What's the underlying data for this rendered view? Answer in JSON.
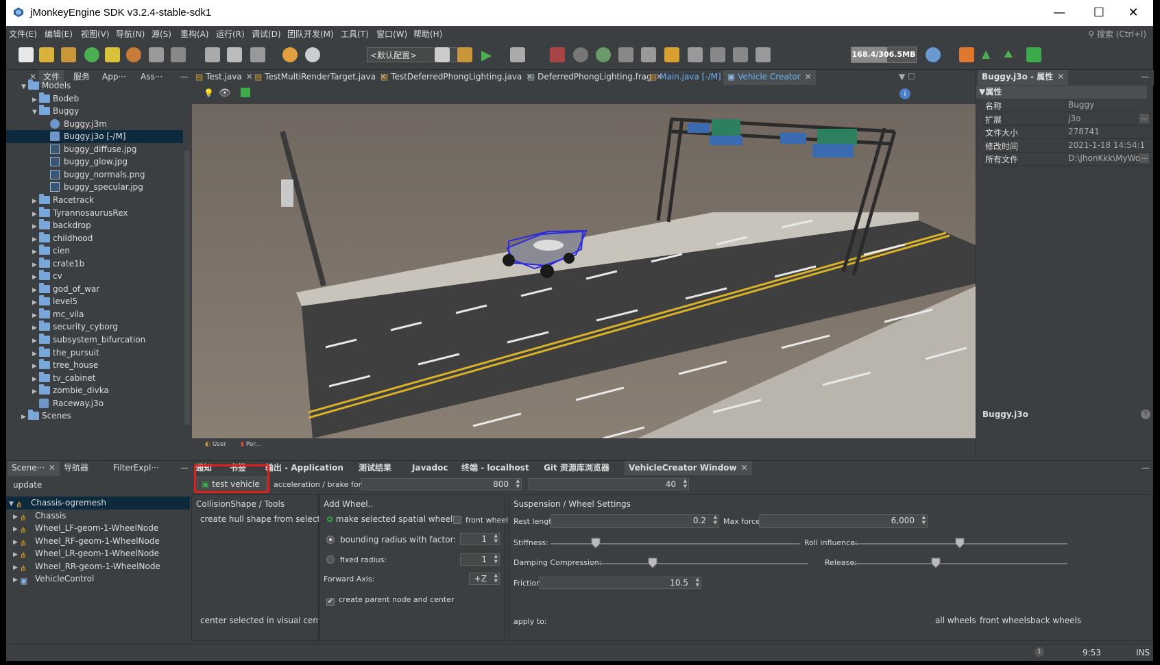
{
  "window": {
    "title": "jMonkeyEngine SDK v3.2.4-stable-sdk1",
    "minimize": "—",
    "maximize": "☐",
    "close": "✕"
  },
  "menu": [
    "文件(E)",
    "编辑(E)",
    "视图(V)",
    "导航(N)",
    "源(S)",
    "重构(A)",
    "运行(R)",
    "调试(D)",
    "团队开发(M)",
    "工具(T)",
    "窗口(W)",
    "帮助(H)"
  ],
  "search": {
    "placeholder": "搜索 (Ctrl+I)"
  },
  "toolbar": {
    "config": "<默认配置>",
    "memory": "168.4/306.5MB",
    "memory_fraction": 0.55
  },
  "left_panel": {
    "tabs": [
      "文件",
      "服务",
      "App···",
      "Ass···"
    ],
    "tree": [
      {
        "label": "Models",
        "depth": 0,
        "open": true,
        "icon": "folder"
      },
      {
        "label": "Bodeb",
        "depth": 1,
        "open": false,
        "icon": "folder"
      },
      {
        "label": "Buggy",
        "depth": 1,
        "open": true,
        "icon": "folder"
      },
      {
        "label": "Buggy.j3m",
        "depth": 2,
        "icon": "material"
      },
      {
        "label": "Buggy.j3o [-/M]",
        "depth": 2,
        "icon": "model",
        "selected": true
      },
      {
        "label": "buggy_diffuse.jpg",
        "depth": 2,
        "icon": "image"
      },
      {
        "label": "buggy_glow.jpg",
        "depth": 2,
        "icon": "image"
      },
      {
        "label": "buggy_normals.png",
        "depth": 2,
        "icon": "image"
      },
      {
        "label": "buggy_specular.jpg",
        "depth": 2,
        "icon": "image"
      },
      {
        "label": "Racetrack",
        "depth": 1,
        "open": false,
        "icon": "folder"
      },
      {
        "label": "TyrannosaurusRex",
        "depth": 1,
        "open": false,
        "icon": "folder"
      },
      {
        "label": "backdrop",
        "depth": 1,
        "open": false,
        "icon": "folder"
      },
      {
        "label": "childhood",
        "depth": 1,
        "open": false,
        "icon": "folder"
      },
      {
        "label": "cien",
        "depth": 1,
        "open": false,
        "icon": "folder"
      },
      {
        "label": "crate1b",
        "depth": 1,
        "open": false,
        "icon": "folder"
      },
      {
        "label": "cv",
        "depth": 1,
        "open": false,
        "icon": "folder"
      },
      {
        "label": "god_of_war",
        "depth": 1,
        "open": false,
        "icon": "folder"
      },
      {
        "label": "level5",
        "depth": 1,
        "open": false,
        "icon": "folder"
      },
      {
        "label": "mc_vila",
        "depth": 1,
        "open": false,
        "icon": "folder"
      },
      {
        "label": "security_cyborg",
        "depth": 1,
        "open": false,
        "icon": "folder"
      },
      {
        "label": "subsystem_bifurcation",
        "depth": 1,
        "open": false,
        "icon": "folder"
      },
      {
        "label": "the_pursuit",
        "depth": 1,
        "open": false,
        "icon": "folder"
      },
      {
        "label": "tree_house",
        "depth": 1,
        "open": false,
        "icon": "folder"
      },
      {
        "label": "tv_cabinet",
        "depth": 1,
        "open": false,
        "icon": "folder"
      },
      {
        "label": "zombie_divka",
        "depth": 1,
        "open": false,
        "icon": "folder"
      },
      {
        "label": "Raceway.j3o",
        "depth": 1,
        "icon": "model"
      },
      {
        "label": "Scenes",
        "depth": 0,
        "open": false,
        "icon": "folder"
      }
    ]
  },
  "scene_panel": {
    "tabs": [
      "Scene···",
      "导航器",
      "FilterExpl···"
    ],
    "update": "update",
    "tree": [
      {
        "label": "Chassis-ogremesh",
        "selected": true,
        "open": true
      },
      {
        "label": "Chassis"
      },
      {
        "label": "Wheel_LF-geom-1-WheelNode"
      },
      {
        "label": "Wheel_RF-geom-1-WheelNode"
      },
      {
        "label": "Wheel_LR-geom-1-WheelNode"
      },
      {
        "label": "Wheel_RR-geom-1-WheelNode"
      },
      {
        "label": "VehicleControl",
        "icon": "control"
      }
    ]
  },
  "editor_tabs": [
    "Test.java",
    "TestMultiRenderTarget.java",
    "TestDeferredPhongLighting.java",
    "DeferredPhongLighting.frag",
    "Main.java [-/M]",
    "Vehicle Creator"
  ],
  "viewport_bottom": [
    "User",
    "Per..."
  ],
  "properties": {
    "tab": "Buggy.j3o - 属性",
    "section": "属性",
    "rows": [
      {
        "k": "名称",
        "v": "Buggy"
      },
      {
        "k": "扩展",
        "v": "j3o"
      },
      {
        "k": "文件大小",
        "v": "278741"
      },
      {
        "k": "修改时间",
        "v": "2021-1-18 14:54:13"
      },
      {
        "k": "所有文件",
        "v": "D:\\JhonKkk\\MyWo..."
      }
    ],
    "footer": "Buggy.j3o"
  },
  "bottom_tabs": [
    "通知",
    "书签",
    "输出 - Application",
    "测试结果",
    "Javadoc",
    "终端 - localhost",
    "Git 资源库浏览器",
    "VehicleCreator Window"
  ],
  "vehicle": {
    "test_button": "test vehicle",
    "accel_label": "acceleration / brake force:",
    "accel_value": "800",
    "brake_value": "40",
    "collision": {
      "title": "CollisionShape / Tools",
      "create_hull": "create hull shape from selected",
      "center": "center selected in visual center"
    },
    "add_wheel": {
      "title": "Add Wheel..",
      "make_wheel": "make selected spatial wheel..",
      "front_wheel": "front wheel",
      "bounding": "bounding radius with factor:",
      "bounding_value": "1",
      "fixed": "fixed radius:",
      "fixed_value": "1",
      "forward_axis": "Forward Axis:",
      "axis_value": "+Z",
      "create_parent": "create parent node and center",
      "create_parent_checked": true
    },
    "suspension": {
      "title": "Suspension / Wheel Settings",
      "rest_length": "Rest length:",
      "rest_value": "0.2",
      "max_force": "Max force:",
      "max_value": "6,000",
      "stiffness": "Stiffness:",
      "stiffness_level": 0.18,
      "roll": "Roll influence:",
      "roll_level": 0.5,
      "damping": "Damping Compression:",
      "damping_level": 0.29,
      "release": "Release:",
      "release_level": 0.4,
      "friction": "Friction:",
      "friction_value": "10.5",
      "apply_to": "apply to:",
      "all": "all wheels",
      "front": "front wheels",
      "back": "back wheels"
    }
  },
  "status": {
    "time": "9:53",
    "mode": "INS",
    "badge": "1"
  }
}
